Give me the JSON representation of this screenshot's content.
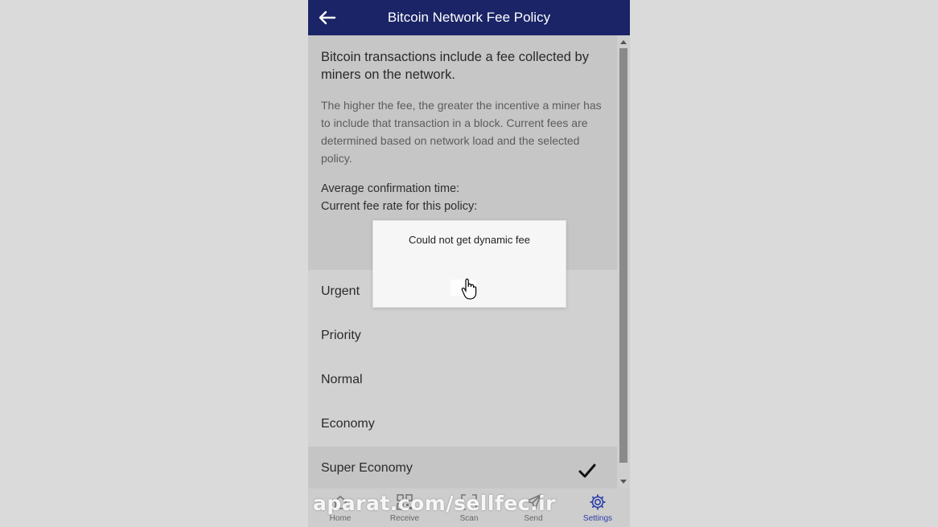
{
  "header": {
    "title": "Bitcoin Network Fee Policy"
  },
  "info": {
    "lead": "Bitcoin transactions include a fee collected by miners on the network.",
    "description": "The higher the fee, the greater the incentive a miner has to include that transaction in a block. Current fees are determined based on network load and the selected policy.",
    "avg_confirmation_label": "Average confirmation time:",
    "fee_rate_label": "Current fee rate for this policy:"
  },
  "options": [
    {
      "label": "Urgent",
      "selected": false
    },
    {
      "label": "Priority",
      "selected": false
    },
    {
      "label": "Normal",
      "selected": false
    },
    {
      "label": "Economy",
      "selected": false
    },
    {
      "label": "Super Economy",
      "selected": true
    }
  ],
  "dialog": {
    "message": "Could not get dynamic fee"
  },
  "nav": [
    {
      "label": "Home",
      "icon": "home-icon",
      "active": false
    },
    {
      "label": "Receive",
      "icon": "qr-code-icon",
      "active": false
    },
    {
      "label": "Scan",
      "icon": "scan-icon",
      "active": false
    },
    {
      "label": "Send",
      "icon": "send-icon",
      "active": false
    },
    {
      "label": "Settings",
      "icon": "gear-icon",
      "active": true
    }
  ],
  "watermark": "aparat.com/sellfec.ir",
  "colors": {
    "header_bg": "#1a2466",
    "active_nav": "#2d3ea8"
  }
}
